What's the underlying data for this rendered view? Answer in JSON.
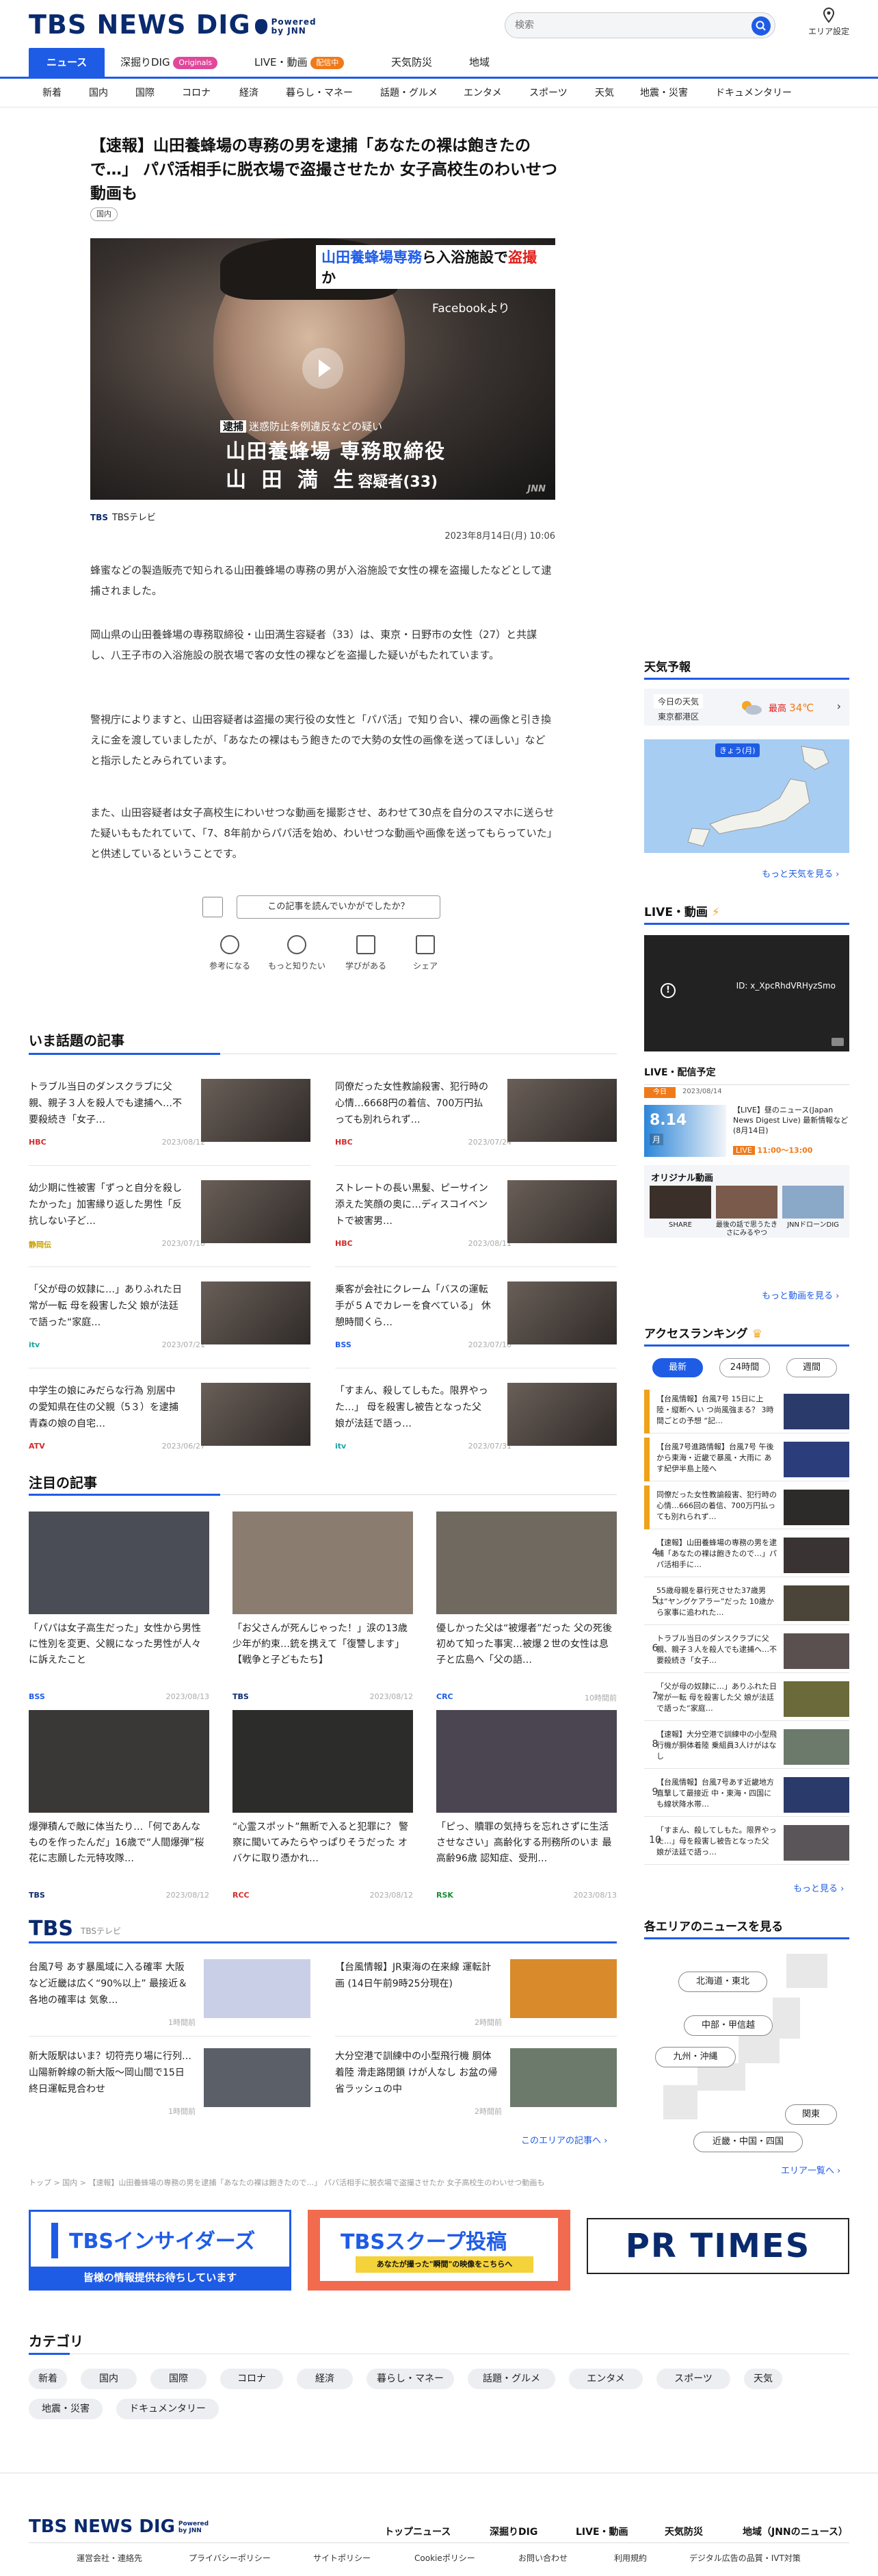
{
  "header": {
    "logo": "TBS NEWS DIG",
    "powered": "Powered",
    "by": "by JNN",
    "search_placeholder": "検索",
    "area_setting": "エリア設定",
    "nav": [
      {
        "label": "ニュース"
      },
      {
        "label": "深掘りDIG",
        "badge": "Originals"
      },
      {
        "label": "LIVE・動画",
        "badge": "配信中"
      },
      {
        "label": "天気防災"
      },
      {
        "label": "地域"
      }
    ],
    "categories": [
      "新着",
      "国内",
      "国際",
      "コロナ",
      "経済",
      "暮らし・マネー",
      "話題・グルメ",
      "エンタメ",
      "スポーツ",
      "天気",
      "地震・災害",
      "ドキュメンタリー"
    ]
  },
  "article": {
    "title": "【速報】山田養蜂場の専務の男を逮捕「あなたの裸は飽きたので…」 パパ活相手に脱衣場で盗撮させたか 女子高校生のわいせつ動画も",
    "tag": "国内",
    "hero": {
      "caption_top_a": "山田養蜂場専務",
      "caption_top_b": "ら入浴施設で",
      "caption_top_c": "盗撮",
      "caption_top_d": "か",
      "facebook": "Facebookより",
      "charge_tag": "逮捕",
      "charge": "迷惑防止条例違反などの疑い",
      "company_role": "山田養蜂場 専務取締役",
      "name": "山 田 満 生",
      "suffix": "容疑者(33)",
      "jnn": "JNN"
    },
    "source_logo": "TBS",
    "source": "TBSテレビ",
    "date": "2023年8月14日(月) 10:06",
    "paragraphs": [
      "蜂蜜などの製造販売で知られる山田養蜂場の専務の男が入浴施設で女性の裸を盗撮したなどとして逮捕されました。",
      "岡山県の山田養蜂場の専務取締役・山田満生容疑者（33）は、東京・日野市の女性（27）と共謀し、八王子市の入浴施設の脱衣場で客の女性の裸などを盗撮した疑いがもたれています。",
      "警視庁によりますと、山田容疑者は盗撮の実行役の女性と「パパ活」で知り合い、裸の画像と引き換えに金を渡していましたが、「あなたの裸はもう飽きたので大勢の女性の画像を送ってほしい」などと指示したとみられています。",
      "また、山田容疑者は女子高校生にわいせつな動画を撮影させ、あわせて30点を自分のスマホに送らせた疑いももたれていて、「7、8年前からパパ活を始め、わいせつな動画や画像を送ってもらっていた」と供述しているということです。"
    ],
    "feedback_question": "この記事を読んでいかがでしたか？",
    "feedback_buttons": [
      "参考になる",
      "もっと知りたい",
      "学びがある",
      "シェア"
    ]
  },
  "popular": {
    "title": "いま話題の記事",
    "items": [
      {
        "title": "トラブル当日のダンスクラブに父親、親子３人を殺人でも逮捕へ…不要殺続き「女子…",
        "source": "HBC",
        "date": "2023/08/12",
        "color": "#d32b2b"
      },
      {
        "title": "同僚だった女性教諭殺害、犯行時の心情…6668円の着信、700万円払っても別れられず…",
        "source": "HBC",
        "date": "2023/07/24",
        "color": "#d32b2b"
      },
      {
        "title": "幼少期に性被害「ずっと自分を殺したかった」加害縁り返した男性「反抗しない子ど…",
        "source": "静岡伝",
        "date": "2023/07/18",
        "color": "#c7a000"
      },
      {
        "title": "ストレートの長い黒髪、ピーサイン添えた笑顔の奥に…ディスコイベントで被害男…",
        "source": "HBC",
        "date": "2023/08/11",
        "color": "#d32b2b"
      },
      {
        "title": "「父が母の奴隷に…」ありふれた日常が一転 母を殺害した父 娘が法廷で語った“家庭…",
        "source": "itv",
        "date": "2023/07/21",
        "color": "#1aa5a5"
      },
      {
        "title": "乗客が会社にクレーム「バスの運転手が５Ａでカレーを食べている」 休憩時間くら…",
        "source": "BSS",
        "date": "2023/07/10",
        "color": "#1f5ce6"
      },
      {
        "title": "中学生の娘にみだらな行為 別居中の愛知県在住の父親（5３）を逮捕 青森の娘の自宅…",
        "source": "ATV",
        "date": "2023/06/27",
        "color": "#d32b2b"
      },
      {
        "title": "「すまん、殺してしもた。限界やった…」 母を殺害し被告となった父 娘が法廷で語っ…",
        "source": "itv",
        "date": "2023/07/31",
        "color": "#1aa5a5"
      }
    ]
  },
  "featured": {
    "title": "注目の記事",
    "items": [
      {
        "title": "「パパは女子高生だった」女性から男性に性別を変更、父親になった男性が人々に訴えたこと",
        "source": "BSS",
        "date": "2023/08/13",
        "color": "#1f5ce6",
        "thumb": "#4a4d55"
      },
      {
        "title": "「お父さんが死んじゃった！」涙の13歳少年が約束…銃を携えて「復讐します」【戦争と子どもたち】",
        "source": "TBS",
        "date": "2023/08/12",
        "color": "#0a2a6e",
        "thumb": "#8a7d70"
      },
      {
        "title": "優しかった父は“被爆者”だった 父の死後 初めて知った事実…被爆２世の女性は息子と広島へ「父の語…",
        "source": "CRC",
        "date": "10時間前",
        "color": "#1f5ce6",
        "thumb": "#6f6960"
      },
      {
        "title": "爆弾積んで敵に体当たり…「何であんなものを作ったんだ」16歳で“人間爆弾”桜花に志願した元特攻隊…",
        "source": "TBS",
        "date": "2023/08/12",
        "color": "#0a2a6e",
        "thumb": "#3a3836"
      },
      {
        "title": "“心霊スポット”無断で入ると犯罪に？ 警察に聞いてみたらやっぱりそうだった オバケに取り憑かれ…",
        "source": "RCC",
        "date": "2023/08/12",
        "color": "#d32b2b",
        "thumb": "#2c2d2b"
      },
      {
        "title": "「ピっ、贖罪の気持ちを忘れさずに生活させなさい」高齢化する刑務所のいま 最高齢96歳 認知症、受刑…",
        "source": "RSK",
        "date": "2023/08/13",
        "color": "#1e8a3a",
        "thumb": "#4a4550"
      }
    ]
  },
  "area_news": {
    "logo": "TBS",
    "sub": "TBSテレビ",
    "items": [
      {
        "title": "台風7号 あす暴風域に入る確率 大阪など近畿は広く“90%以上” 最接近＆各地の確率は 気象…",
        "date": "1時間前",
        "thumb": "#c9cfe6"
      },
      {
        "title": "【台風情報】JR東海の在来線 運転計画 (14日午前9時25分現在)",
        "date": "2時間前",
        "thumb": "#d98a2a"
      },
      {
        "title": "新大阪駅はいま？切符売り場に行列…山陽新幹線の新大阪～岡山間で15日終日運転見合わせ",
        "date": "1時間前",
        "thumb": "#5a5f68"
      },
      {
        "title": "大分空港で訓練中の小型飛行機 胴体着陸 滑走路閉鎖 けが人なし お盆の帰省ラッシュの中",
        "date": "2時間前",
        "thumb": "#6b7a6b"
      }
    ],
    "more": "このエリアの記事へ"
  },
  "breadcrumb": "トップ > 国内 > 【速報】山田養蜂場の専務の男を逮捕「あなたの裸は飽きたので…」 パパ活相手に脱衣場で盗撮させたか 女子高校生のわいせつ動画も",
  "banners": {
    "insiders": "TBSインサイダーズ",
    "insiders_sub": "皆様の情報提供お待ちしています",
    "scoop": "TBSスクープ投稿",
    "scoop_sub": "あなたが撮った\"瞬間\"の映像をこちらへ",
    "prtimes": "PR TIMES"
  },
  "category": {
    "title": "カテゴリ",
    "items": [
      "新着",
      "国内",
      "国際",
      "コロナ",
      "経済",
      "暮らし・マネー",
      "話題・グルメ",
      "エンタメ",
      "スポーツ",
      "天気",
      "地震・災害",
      "ドキュメンタリー"
    ]
  },
  "sidebar": {
    "weather": {
      "title": "天気予報",
      "today": "今日の天気",
      "region": "東京都港区",
      "max_label": "最高",
      "max": "34℃",
      "map_label": "きょう(月)",
      "more": "もっと天気を見る"
    },
    "live": {
      "title": "LIVE・動画",
      "video_error": "ID: x_XpcRhdVRHyzSmo",
      "schedule_title": "LIVE・配信予定",
      "badge": "今日",
      "date": "2023/08/14",
      "thumb_date": "8.14",
      "thumb_day": "月",
      "program": "【LIVE】昼のニュース(Japan News Digest Live) 最新情報など(8月14日)",
      "live_badge": "LIVE",
      "time": "11:00～13:00",
      "original_title": "オリジナル動画",
      "originals": [
        "SHARE",
        "最後の話で思うたきさにみるやつ",
        "JNNドローンDIG"
      ],
      "more": "もっと動画を見る"
    },
    "ranking": {
      "title": "アクセスランキング",
      "tabs": [
        "最新",
        "24時間",
        "週間"
      ],
      "items": [
        {
          "title": "【台風情報】台風7号 15日に上陸・縦断へ い つ尚風強まる？ 3時間ごとの予想 “記…",
          "thumb": "#2a3a6a",
          "rank_color": "#f0a21a"
        },
        {
          "title": "【台風7号進路情報】台風7号 午後から東海・近畿で暴風・大雨に あす紀伊半島上陸へ",
          "thumb": "#2b3d7a",
          "rank_color": "#f0a21a"
        },
        {
          "title": "同僚だった女性教諭殺害、犯行時の心情…666回の着信、700万円払っても別れられず…",
          "thumb": "#2d2a2a",
          "rank_color": "#f0a21a"
        },
        {
          "title": "【速報】山田養蜂場の専務の男を逮捕「あなたの裸は飽きたので…」パパ活相手に…",
          "thumb": "#3a3333",
          "rank_color": "#fff"
        },
        {
          "title": "55歳母親を暴行死させた37歳男は“ヤングケアラー”だった 10歳から家事に追われた…",
          "thumb": "#4a4538",
          "rank_color": "#fff"
        },
        {
          "title": "トラブル当日のダンスクラブに父親、親子３人を殺人でも逮捕へ…不要殺続き「女子…",
          "thumb": "#5a5050",
          "rank_color": "#fff"
        },
        {
          "title": "「父が母の奴隷に…」ありふれた日常が一転 母を殺害した父 娘が法廷で語った“家庭…",
          "thumb": "#6a6a3a",
          "rank_color": "#fff"
        },
        {
          "title": "【速報】大分空港で訓練中の小型飛行機が胴体着陸 乗組員3人けがはなし",
          "thumb": "#6b7a6b",
          "rank_color": "#fff"
        },
        {
          "title": "【台風情報】台風7号あす近畿地方直撃して最接近 中・東海・四国にも線状降水帯…",
          "thumb": "#2a3a6a",
          "rank_color": "#fff"
        },
        {
          "title": "「すまん、殺してしもた。限界やった…」母を殺害し被告となった父 娘が法廷で語っ…",
          "thumb": "#5a5558",
          "rank_color": "#fff"
        }
      ],
      "more": "もっと見る"
    },
    "areas": {
      "title": "各エリアのニュースを見る",
      "buttons": [
        "北海道・東北",
        "中部・甲信越",
        "九州・沖縄",
        "関東",
        "近畿・中国・四国"
      ],
      "more": "エリア一覧へ"
    }
  },
  "footer": {
    "logo": "TBS NEWS DIG",
    "links": [
      "トップニュース",
      "深掘りDIG",
      "LIVE・動画",
      "天気防災",
      "地域（JNNのニュース）"
    ],
    "small": [
      "運営会社・連絡先",
      "プライバシーポリシー",
      "サイトポリシー",
      "Cookieポリシー",
      "お問い合わせ",
      "利用規約",
      "デジタル広告の品質・IVT対策"
    ]
  },
  "colors": {
    "accent": "#1f5ce6",
    "brand": "#0a2a6e",
    "orange": "#f07a1a"
  }
}
